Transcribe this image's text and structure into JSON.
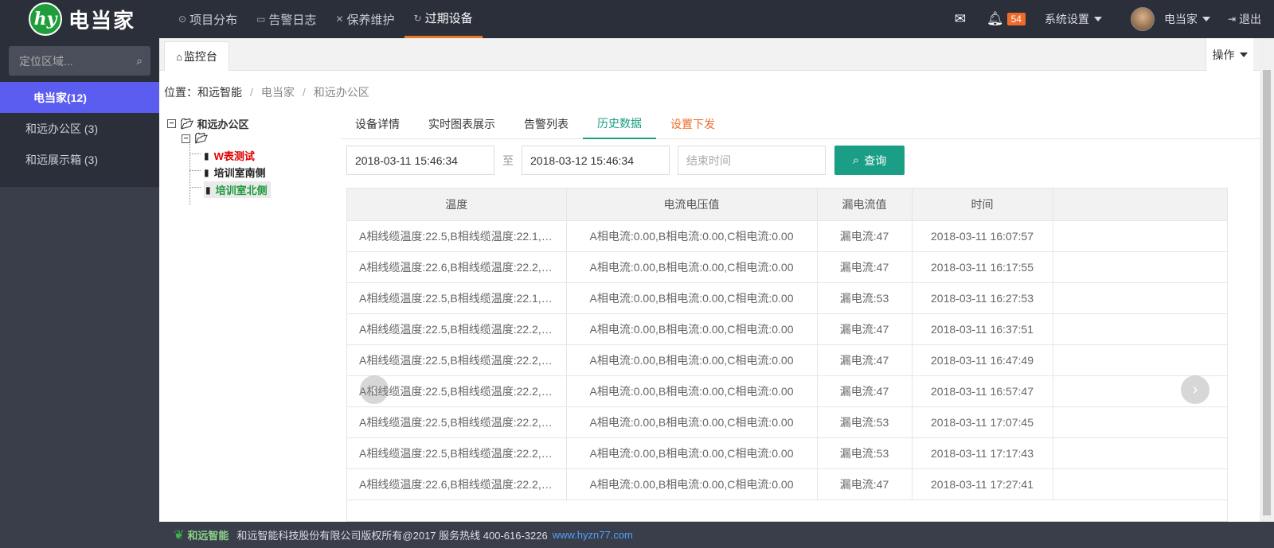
{
  "app": {
    "logo_mark": "hy",
    "logo_text": "电当家"
  },
  "nav": [
    {
      "label": "项目分布",
      "icon": "map-pin-icon",
      "glyph": "⊙"
    },
    {
      "label": "告警日志",
      "icon": "log-icon",
      "glyph": "▭"
    },
    {
      "label": "保养维护",
      "icon": "wrench-icon",
      "glyph": "✕"
    },
    {
      "label": "过期设备",
      "icon": "refresh-icon",
      "glyph": "↻",
      "active": true
    }
  ],
  "topright": {
    "mail_icon": "mail-icon",
    "bell_icon": "bell-icon",
    "badge": "54",
    "settings": "系统设置",
    "user": "电当家",
    "logout": "退出"
  },
  "sidebar": {
    "search_placeholder": "定位区域...",
    "items": [
      {
        "label": "电当家(12)",
        "active": true
      },
      {
        "label": "和远办公区 (3)"
      },
      {
        "label": "和远展示箱 (3)"
      }
    ]
  },
  "tabs": {
    "home": "监控台",
    "ops": "操作"
  },
  "breadcrumb": {
    "prefix": "位置：",
    "p1": "和远智能",
    "p2": "电当家",
    "p3": "和远办公区"
  },
  "tree": {
    "root": "和远办公区",
    "sub": "",
    "leaves": [
      "W表测试",
      "培训室南侧",
      "培训室北侧"
    ]
  },
  "subtabs": [
    "设备详情",
    "实时图表展示",
    "告警列表",
    "历史数据",
    "设置下发"
  ],
  "filters": {
    "start": "2018-03-11 15:46:34",
    "to": "至",
    "end": "2018-03-12 15:46:34",
    "end_placeholder": "结束时间",
    "query": "查询"
  },
  "table": {
    "headers": [
      "温度",
      "电流电压值",
      "漏电流值",
      "时间"
    ],
    "rows": [
      [
        "A相线缆温度:22.5,B相线缆温度:22.1,C...",
        "A相电流:0.00,B相电流:0.00,C相电流:0.00",
        "漏电流:47",
        "2018-03-11 16:07:57"
      ],
      [
        "A相线缆温度:22.6,B相线缆温度:22.2,C...",
        "A相电流:0.00,B相电流:0.00,C相电流:0.00",
        "漏电流:47",
        "2018-03-11 16:17:55"
      ],
      [
        "A相线缆温度:22.5,B相线缆温度:22.1,C...",
        "A相电流:0.00,B相电流:0.00,C相电流:0.00",
        "漏电流:53",
        "2018-03-11 16:27:53"
      ],
      [
        "A相线缆温度:22.5,B相线缆温度:22.2,C...",
        "A相电流:0.00,B相电流:0.00,C相电流:0.00",
        "漏电流:47",
        "2018-03-11 16:37:51"
      ],
      [
        "A相线缆温度:22.5,B相线缆温度:22.2,C...",
        "A相电流:0.00,B相电流:0.00,C相电流:0.00",
        "漏电流:47",
        "2018-03-11 16:47:49"
      ],
      [
        "A相线缆温度:22.5,B相线缆温度:22.2,C...",
        "A相电流:0.00,B相电流:0.00,C相电流:0.00",
        "漏电流:47",
        "2018-03-11 16:57:47"
      ],
      [
        "A相线缆温度:22.5,B相线缆温度:22.2,C...",
        "A相电流:0.00,B相电流:0.00,C相电流:0.00",
        "漏电流:53",
        "2018-03-11 17:07:45"
      ],
      [
        "A相线缆温度:22.5,B相线缆温度:22.2,C...",
        "A相电流:0.00,B相电流:0.00,C相电流:0.00",
        "漏电流:53",
        "2018-03-11 17:17:43"
      ],
      [
        "A相线缆温度:22.6,B相线缆温度:22.2,C...",
        "A相电流:0.00,B相电流:0.00,C相电流:0.00",
        "漏电流:47",
        "2018-03-11 17:27:41"
      ]
    ]
  },
  "footer": {
    "logo": "和远智能",
    "text": "和远智能科技股份有限公司版权所有@2017 服务热线 400-616-3226",
    "link": "www.hyzn77.com"
  }
}
